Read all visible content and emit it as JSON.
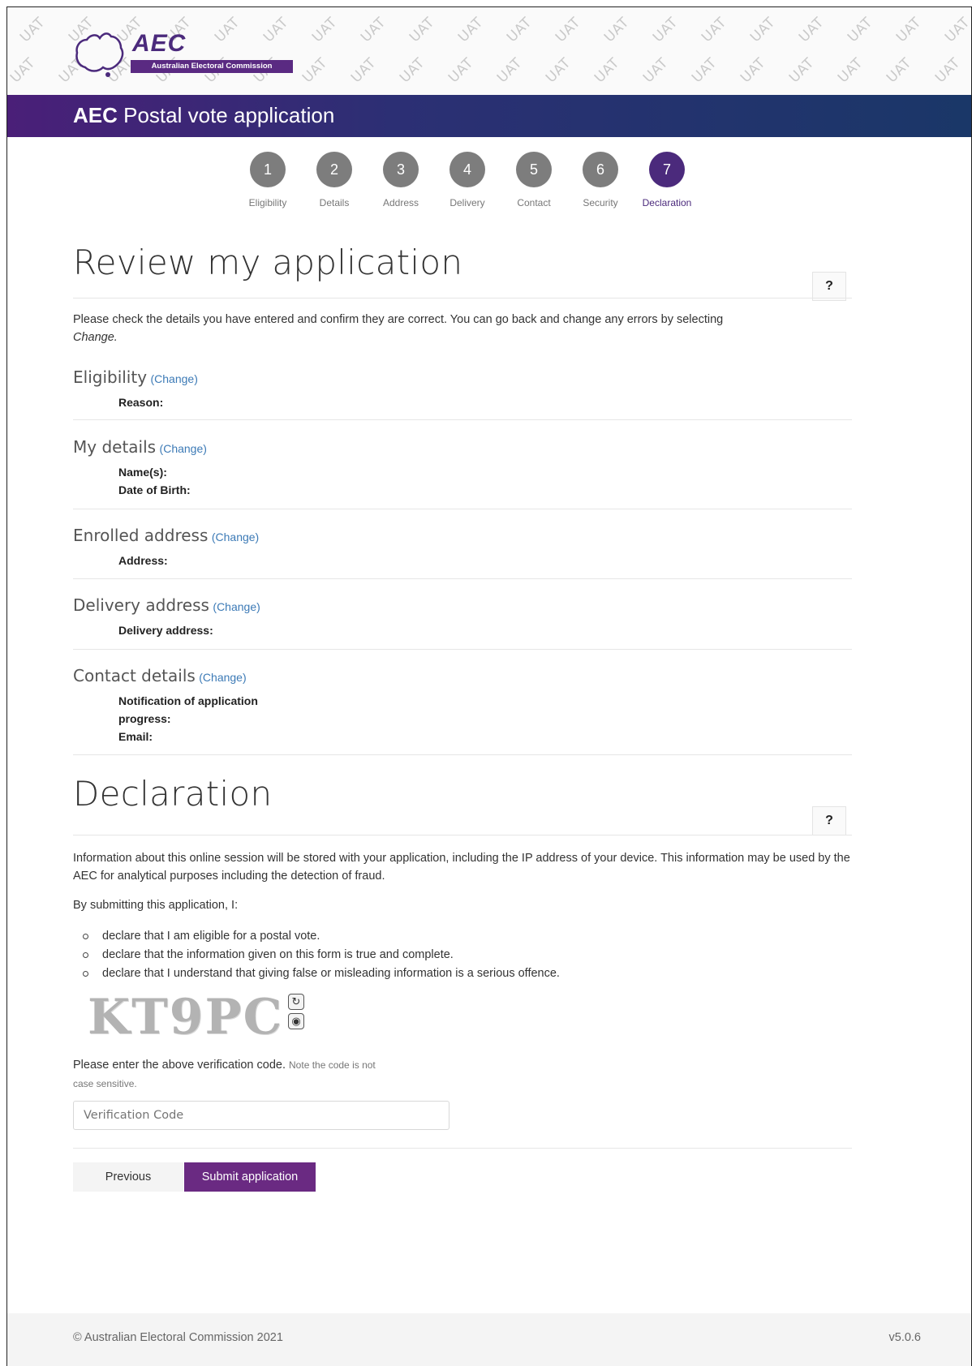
{
  "header": {
    "watermark": "UAT",
    "logo_text": "AEC",
    "logo_subtitle": "Australian Electoral Commission",
    "title_bold": "AEC",
    "title_rest": " Postal vote application"
  },
  "stepper": {
    "steps": [
      {
        "num": "1",
        "label": "Eligibility"
      },
      {
        "num": "2",
        "label": "Details"
      },
      {
        "num": "3",
        "label": "Address"
      },
      {
        "num": "4",
        "label": "Delivery"
      },
      {
        "num": "5",
        "label": "Contact"
      },
      {
        "num": "6",
        "label": "Security"
      },
      {
        "num": "7",
        "label": "Declaration"
      }
    ],
    "active_step": 7
  },
  "review": {
    "heading": "Review my application",
    "help_label": "?",
    "intro": "Please check the details you have entered and confirm they are correct. You can go back and change any errors by selecting",
    "intro_emphasis": "Change.",
    "change_label": "(Change)",
    "sections": [
      {
        "title": "Eligibility",
        "fields": [
          "Reason:"
        ]
      },
      {
        "title": "My details",
        "fields": [
          "Name(s):",
          "Date of Birth:"
        ]
      },
      {
        "title": "Enrolled address",
        "fields": [
          "Address:"
        ]
      },
      {
        "title": "Delivery address",
        "fields": [
          "Delivery address:"
        ]
      },
      {
        "title": "Contact details",
        "fields": [
          "Notification of application",
          "progress:",
          "Email:"
        ]
      }
    ]
  },
  "declaration": {
    "heading": "Declaration",
    "help_label": "?",
    "info": "Information about this online session will be stored with your application, including the IP address of your device. This information may be used by the AEC for analytical purposes including the detection of fraud.",
    "lead": "By submitting this application, I:",
    "items": [
      "declare that I am eligible for a postal vote.",
      "declare that the information given on this form is true and complete.",
      "declare that I understand that giving false or misleading information is a serious offence."
    ],
    "captcha_code": "KT9PC",
    "verify_prompt": "Please enter the above verification code.",
    "verify_note_1": "Note the code is not",
    "verify_note_2": "case sensitive.",
    "verification_placeholder": "Verification Code",
    "verification_value": ""
  },
  "actions": {
    "previous_label": "Previous",
    "submit_label": "Submit application"
  },
  "footer": {
    "copyright": "© Australian Electoral Commission 2021",
    "version": "v5.0.6"
  },
  "colors": {
    "brand_purple": "#4b2a7c",
    "submit_purple": "#6a2a82",
    "link_blue": "#3c7ab6",
    "title_bar_dark": "#1a3768"
  }
}
